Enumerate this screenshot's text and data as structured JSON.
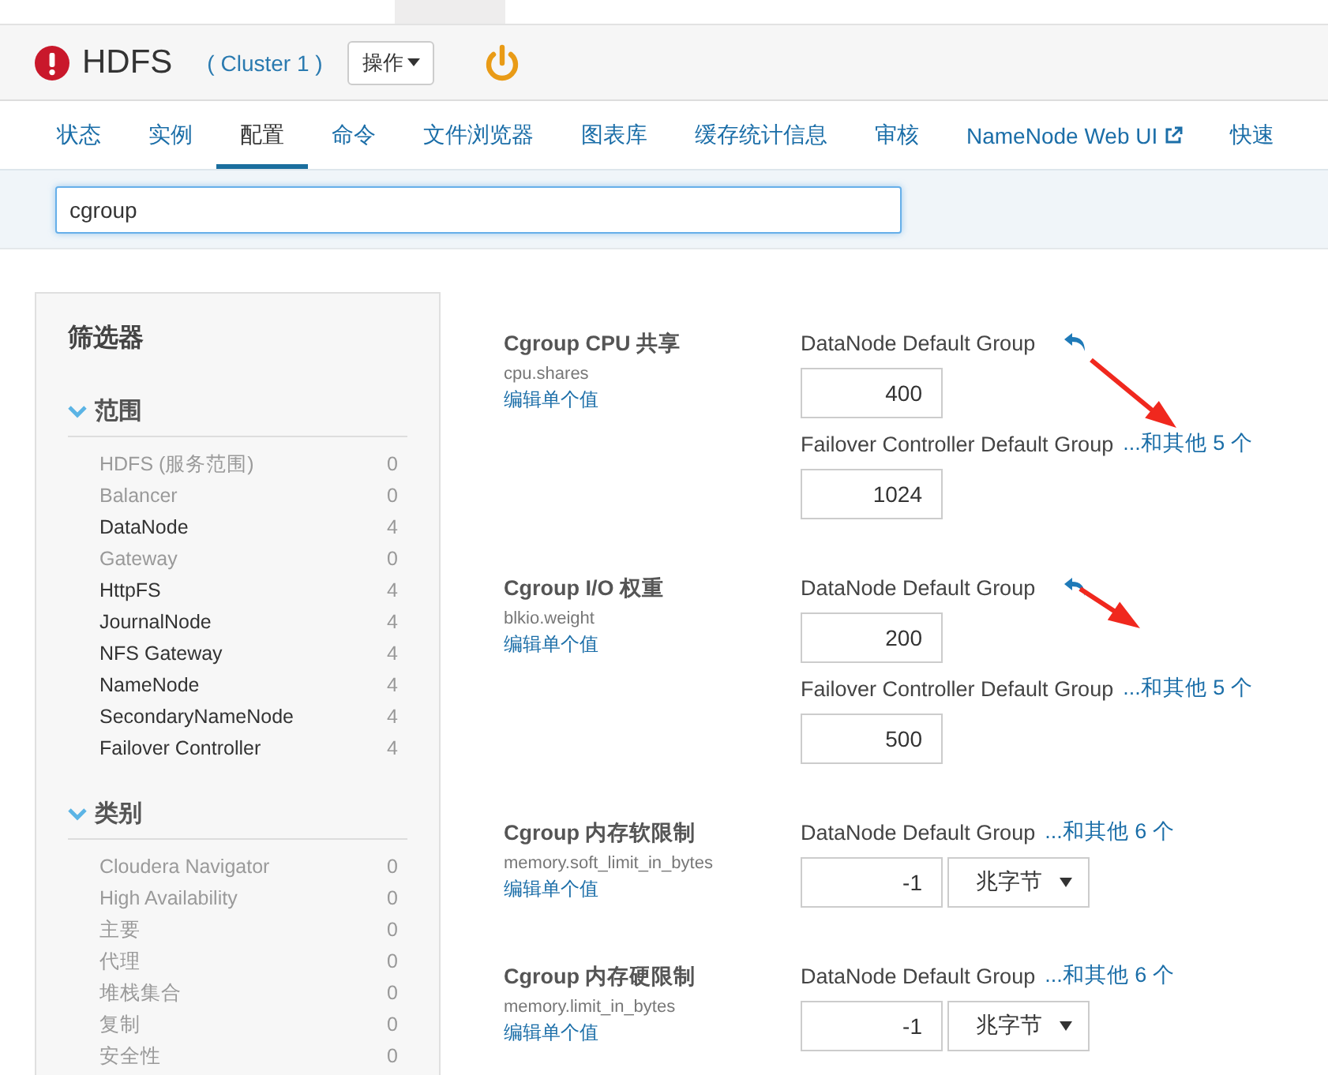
{
  "service": {
    "name": "HDFS",
    "cluster": "( Cluster 1 )",
    "actions_button": "操作"
  },
  "tabs": [
    {
      "label": "状态",
      "selected": false,
      "external": false
    },
    {
      "label": "实例",
      "selected": false,
      "external": false
    },
    {
      "label": "配置",
      "selected": true,
      "external": false
    },
    {
      "label": "命令",
      "selected": false,
      "external": false
    },
    {
      "label": "文件浏览器",
      "selected": false,
      "external": false
    },
    {
      "label": "图表库",
      "selected": false,
      "external": false
    },
    {
      "label": "缓存统计信息",
      "selected": false,
      "external": false
    },
    {
      "label": "审核",
      "selected": false,
      "external": false
    },
    {
      "label": "NameNode Web UI",
      "selected": false,
      "external": true
    },
    {
      "label": "快速",
      "selected": false,
      "external": false
    }
  ],
  "search": {
    "value": "cgroup"
  },
  "filters": {
    "title": "筛选器",
    "sections": [
      {
        "title": "范围",
        "expanded": true,
        "items": [
          {
            "label": "HDFS (服务范围)",
            "count": "0",
            "disabled": true
          },
          {
            "label": "Balancer",
            "count": "0",
            "disabled": true
          },
          {
            "label": "DataNode",
            "count": "4",
            "disabled": false
          },
          {
            "label": "Gateway",
            "count": "0",
            "disabled": true
          },
          {
            "label": "HttpFS",
            "count": "4",
            "disabled": false
          },
          {
            "label": "JournalNode",
            "count": "4",
            "disabled": false
          },
          {
            "label": "NFS Gateway",
            "count": "4",
            "disabled": false
          },
          {
            "label": "NameNode",
            "count": "4",
            "disabled": false
          },
          {
            "label": "SecondaryNameNode",
            "count": "4",
            "disabled": false
          },
          {
            "label": "Failover Controller",
            "count": "4",
            "disabled": false
          }
        ]
      },
      {
        "title": "类别",
        "expanded": true,
        "items": [
          {
            "label": "Cloudera Navigator",
            "count": "0",
            "disabled": true
          },
          {
            "label": "High Availability",
            "count": "0",
            "disabled": true
          },
          {
            "label": "主要",
            "count": "0",
            "disabled": true
          },
          {
            "label": "代理",
            "count": "0",
            "disabled": true
          },
          {
            "label": "堆栈集合",
            "count": "0",
            "disabled": true
          },
          {
            "label": "复制",
            "count": "0",
            "disabled": true
          },
          {
            "label": "安全性",
            "count": "0",
            "disabled": true
          }
        ]
      }
    ]
  },
  "settings": [
    {
      "title": "Cgroup CPU 共享",
      "key": "cpu.shares",
      "edit_link": "编辑单个值",
      "groups": [
        {
          "label": "DataNode Default Group",
          "revert": true,
          "value": "400"
        },
        {
          "label": "Failover Controller Default Group",
          "revert": false,
          "others": "...和其他 5 个",
          "value": "1024"
        }
      ]
    },
    {
      "title": "Cgroup I/O 权重",
      "key": "blkio.weight",
      "edit_link": "编辑单个值",
      "groups": [
        {
          "label": "DataNode Default Group",
          "revert": true,
          "value": "200"
        },
        {
          "label": "Failover Controller Default Group",
          "revert": false,
          "others": "...和其他 5 个",
          "value": "500"
        }
      ]
    },
    {
      "title": "Cgroup 内存软限制",
      "key": "memory.soft_limit_in_bytes",
      "edit_link": "编辑单个值",
      "groups": [
        {
          "label": "DataNode Default Group",
          "revert": false,
          "others": "...和其他 6 个",
          "value": "-1",
          "unit": "兆字节"
        }
      ]
    },
    {
      "title": "Cgroup 内存硬限制",
      "key": "memory.limit_in_bytes",
      "edit_link": "编辑单个值",
      "groups": [
        {
          "label": "DataNode Default Group",
          "revert": false,
          "others": "...和其他 6 个",
          "value": "-1",
          "unit": "兆字节"
        }
      ]
    }
  ]
}
